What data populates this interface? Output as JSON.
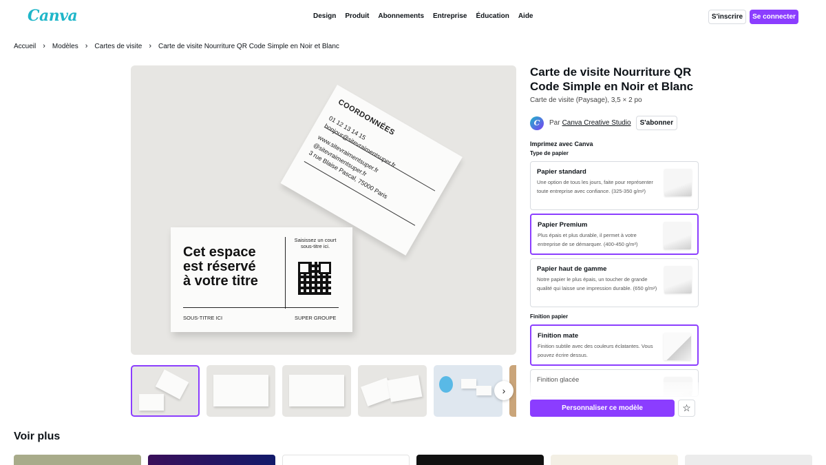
{
  "header": {
    "logo": "Canva",
    "nav": [
      "Design",
      "Produit",
      "Abonnements",
      "Entreprise",
      "Éducation",
      "Aide"
    ],
    "signup": "S'inscrire",
    "login": "Se connecter"
  },
  "breadcrumb": [
    "Accueil",
    "Modèles",
    "Cartes de visite",
    "Carte de visite Nourriture QR Code Simple en Noir et Blanc"
  ],
  "preview": {
    "back_card": {
      "title": "COORDONNÉES",
      "phone": "01 12 13 14 15",
      "email": "bonjour@sitevraimentsuper.fr",
      "site": "www.sitevraimentsuper.fr",
      "handle": "@sitevraimentsuper.fr",
      "address": "3 rue Blaise Pascal, 75000 Paris"
    },
    "front_card": {
      "title_l1": "Cet espace",
      "title_l2": "est réservé",
      "title_l3": "à votre titre",
      "subtitle": "Saisissez un court sous-titre ici.",
      "footer_left": "SOUS-TITRE ICI",
      "footer_right": "SUPER GROUPE"
    }
  },
  "product": {
    "title": "Carte de visite Nourriture QR Code Simple en Noir et Blanc",
    "subtitle": "Carte de visite (Paysage), 3,5 × 2 po",
    "by": "Par",
    "author": "Canva Creative Studio",
    "subscribe": "S'abonner",
    "print_heading": "Imprimez avec Canva",
    "paper_type_label": "Type de papier",
    "papers": [
      {
        "name": "Papier standard",
        "desc": "Une option de tous les jours, faite pour représenter toute entreprise avec confiance. (325-350 g/m²)"
      },
      {
        "name": "Papier Premium",
        "desc": "Plus épais et plus durable, il permet à votre entreprise de se démarquer. (400-450 g/m²)"
      },
      {
        "name": "Papier haut de gamme",
        "desc": "Notre papier le plus épais, un toucher de grande qualité qui laisse une impression durable. (650 g/m²)"
      }
    ],
    "finish_label": "Finition papier",
    "finishes": [
      {
        "name": "Finition mate",
        "desc": "Finition subtile avec des couleurs éclatantes. Vous pouvez écrire dessus."
      },
      {
        "name": "Finition glacée",
        "desc": ""
      }
    ],
    "cta": "Personnaliser ce modèle"
  },
  "more": {
    "title": "Voir plus"
  },
  "colors": {
    "accent": "#8b3dff",
    "logo": "#1fb6c9"
  }
}
